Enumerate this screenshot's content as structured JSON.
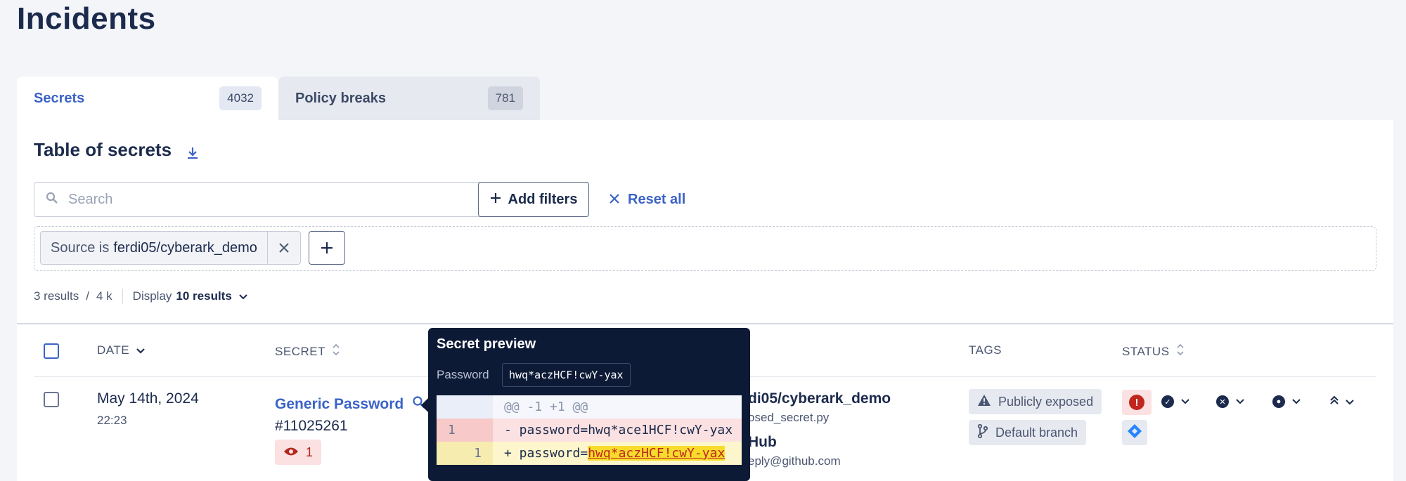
{
  "page": {
    "title": "Incidents"
  },
  "tabs": [
    {
      "label": "Secrets",
      "count": "4032"
    },
    {
      "label": "Policy breaks",
      "count": "781"
    }
  ],
  "table": {
    "title": "Table of secrets",
    "search_placeholder": "Search",
    "add_filters_label": "Add filters",
    "reset_label": "Reset all",
    "filter_chip": {
      "prefix": "Source is",
      "value": "ferdi05/cyberark_demo"
    },
    "results_count": "3 results",
    "results_total": "4 k",
    "display_label": "Display",
    "display_value": "10 results",
    "columns": {
      "date": "DATE",
      "secret": "SECRET",
      "tags": "TAGS",
      "status": "STATUS"
    }
  },
  "row": {
    "date": "May 14th, 2024",
    "time": "22:23",
    "secret_name": "Generic Password",
    "secret_id": "#11025261",
    "viewers_count": "1",
    "source_repo": "di05/cyberark_demo",
    "source_file": "osed_secret.py",
    "author_name": "Hub",
    "author_email": "eply@github.com",
    "tags": [
      "Publicly exposed",
      "Default branch"
    ]
  },
  "tooltip": {
    "title": "Secret preview",
    "kind": "Password",
    "value": "hwq*aczHCF!cwY-yax",
    "hunk": "@@ -1 +1 @@",
    "del_line_no": "1",
    "del_code": "- password=hwq*ace1HCF!cwY-yax",
    "add_line_no": "1",
    "add_prefix": "+ password=",
    "add_secret": "hwq*aczHCF!cwY-yax"
  },
  "colors": {
    "accent": "#3b63c7",
    "tooltip_bg": "#0d1a36",
    "alert": "#c0261e"
  }
}
